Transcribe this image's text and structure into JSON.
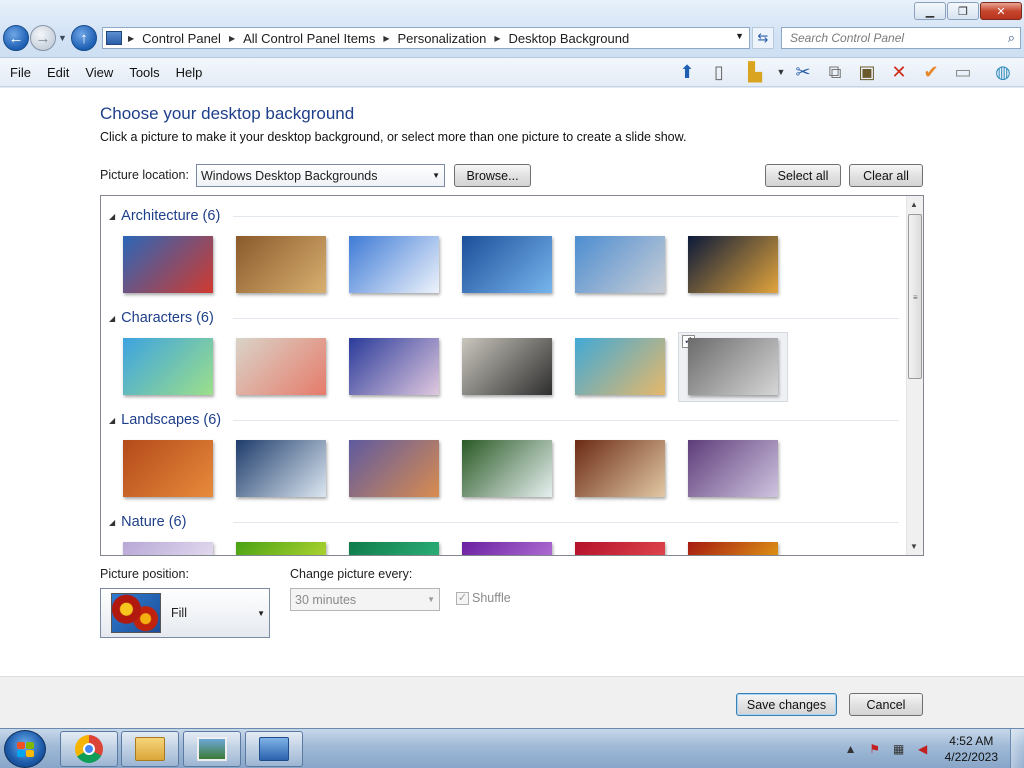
{
  "window": {
    "breadcrumb": [
      "Control Panel",
      "All Control Panel Items",
      "Personalization",
      "Desktop Background"
    ],
    "search_placeholder": "Search Control Panel"
  },
  "menu": [
    "File",
    "Edit",
    "View",
    "Tools",
    "Help"
  ],
  "toolbar_icons": [
    "up-icon",
    "pane-icon",
    "folder-options-icon",
    "cut-icon",
    "copy-icon",
    "paste-icon",
    "delete-icon",
    "check-icon",
    "properties-icon",
    "network-icon"
  ],
  "main": {
    "heading": "Choose your desktop background",
    "subtext": "Click a picture to make it your desktop background, or select more than one picture to create a slide show.",
    "picture_location_label": "Picture location:",
    "picture_location_value": "Windows Desktop Backgrounds",
    "browse_label": "Browse...",
    "select_all_label": "Select all",
    "clear_all_label": "Clear all"
  },
  "groups": [
    {
      "title": "Architecture (6)",
      "colors": [
        [
          "#2b66b8",
          "#d13a2f"
        ],
        [
          "#8a5a2b",
          "#d9b071"
        ],
        [
          "#3f7bd6",
          "#eef3fb"
        ],
        [
          "#1c4f9a",
          "#77b4ec"
        ],
        [
          "#4d8dd1",
          "#c9ced6"
        ],
        [
          "#0c1a3a",
          "#e2a43b"
        ]
      ],
      "selected": []
    },
    {
      "title": "Characters (6)",
      "colors": [
        [
          "#3da3e0",
          "#9cdf8a"
        ],
        [
          "#d9d4c8",
          "#e67b6b"
        ],
        [
          "#2a3b9a",
          "#e0c8df"
        ],
        [
          "#c9c6bd",
          "#2e2e2e"
        ],
        [
          "#41a9d6",
          "#e6b86a"
        ],
        [
          "#6b6b6b",
          "#d6d6d6"
        ]
      ],
      "selected": [
        5
      ]
    },
    {
      "title": "Landscapes (6)",
      "colors": [
        [
          "#b34a1a",
          "#e88b3c"
        ],
        [
          "#1e3c6b",
          "#dce7f1"
        ],
        [
          "#5e5aa0",
          "#d98c4f"
        ],
        [
          "#2a5a25",
          "#e7f0f1"
        ],
        [
          "#6b2a14",
          "#e3c9a5"
        ],
        [
          "#5e3d7a",
          "#cfc4e0"
        ]
      ],
      "selected": []
    },
    {
      "title": "Nature (6)",
      "colors": [
        [
          "#b7a7d6",
          "#f3eef8"
        ],
        [
          "#4aa114",
          "#d2e63b"
        ],
        [
          "#0f7b4a",
          "#36c28a"
        ],
        [
          "#6a1fa0",
          "#c88be6"
        ],
        [
          "#b3102a",
          "#f05a5a"
        ],
        [
          "#a51a12",
          "#f3c215"
        ]
      ],
      "selected": []
    }
  ],
  "position": {
    "label": "Picture position:",
    "value": "Fill"
  },
  "change_every": {
    "label": "Change picture every:",
    "value": "30 minutes"
  },
  "shuffle_label": "Shuffle",
  "footer": {
    "save_label": "Save changes",
    "cancel_label": "Cancel"
  },
  "taskbar": {
    "time": "4:52 AM",
    "date": "4/22/2023",
    "apps": [
      "chrome-icon",
      "explorer-icon",
      "pictures-icon",
      "control-panel-icon"
    ]
  }
}
